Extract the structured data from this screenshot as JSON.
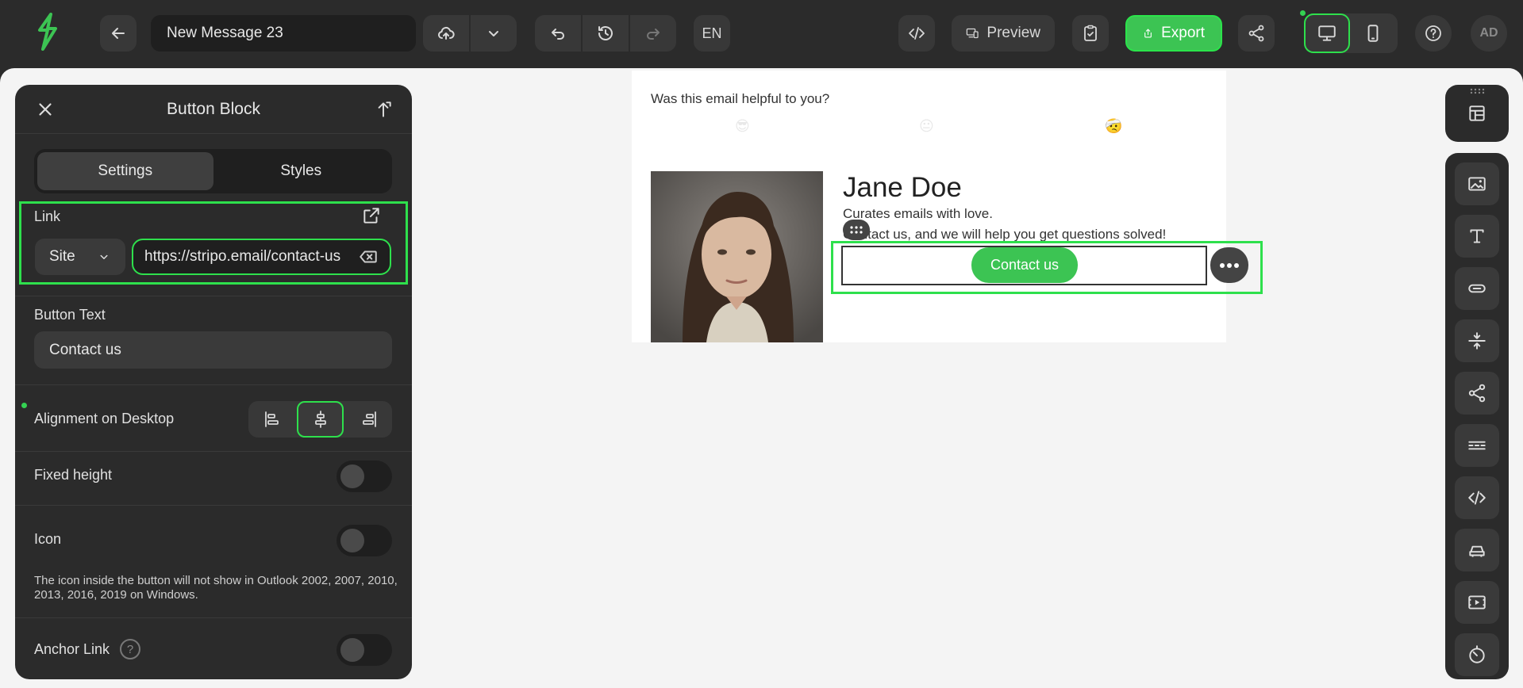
{
  "header": {
    "title": "New Message 23",
    "language": "EN",
    "preview_label": "Preview",
    "export_label": "Export",
    "user_initials": "AD"
  },
  "panel": {
    "title": "Button Block",
    "tabs": [
      {
        "label": "Settings",
        "active": true
      },
      {
        "label": "Styles",
        "active": false
      }
    ],
    "link": {
      "label": "Link",
      "type": "Site",
      "url": "https://stripo.email/contact-us"
    },
    "button_text": {
      "label": "Button Text",
      "value": "Contact us"
    },
    "alignment": {
      "label": "Alignment on Desktop",
      "selected": "center"
    },
    "fixed_height": {
      "label": "Fixed height",
      "on": false
    },
    "icon": {
      "label": "Icon",
      "on": false,
      "note": "The icon inside the button will not show in Outlook 2002, 2007, 2010, 2013, 2016, 2019 on Windows."
    },
    "anchor_link": {
      "label": "Anchor Link",
      "on": false,
      "help": "?"
    }
  },
  "email": {
    "helpful_question": "Was this email helpful to you?",
    "emojis": [
      "😎",
      "😐",
      "🤕"
    ],
    "person_name": "Jane Doe",
    "tagline": "Curates emails with love.",
    "help_text": "Contact us, and we will help you get questions solved!",
    "button_label": "Contact us"
  },
  "right_toolbar": {
    "items": [
      "image-block-icon",
      "text-block-icon",
      "button-block-icon",
      "spacer-block-icon",
      "social-block-icon",
      "menu-block-icon",
      "html-block-icon",
      "banner-block-icon",
      "video-block-icon",
      "timer-block-icon"
    ]
  },
  "colors": {
    "accent": "#3cc453",
    "highlight": "#2ee04c",
    "dark_bg": "#2b2b2b",
    "canvas_bg": "#f4f4f4"
  }
}
